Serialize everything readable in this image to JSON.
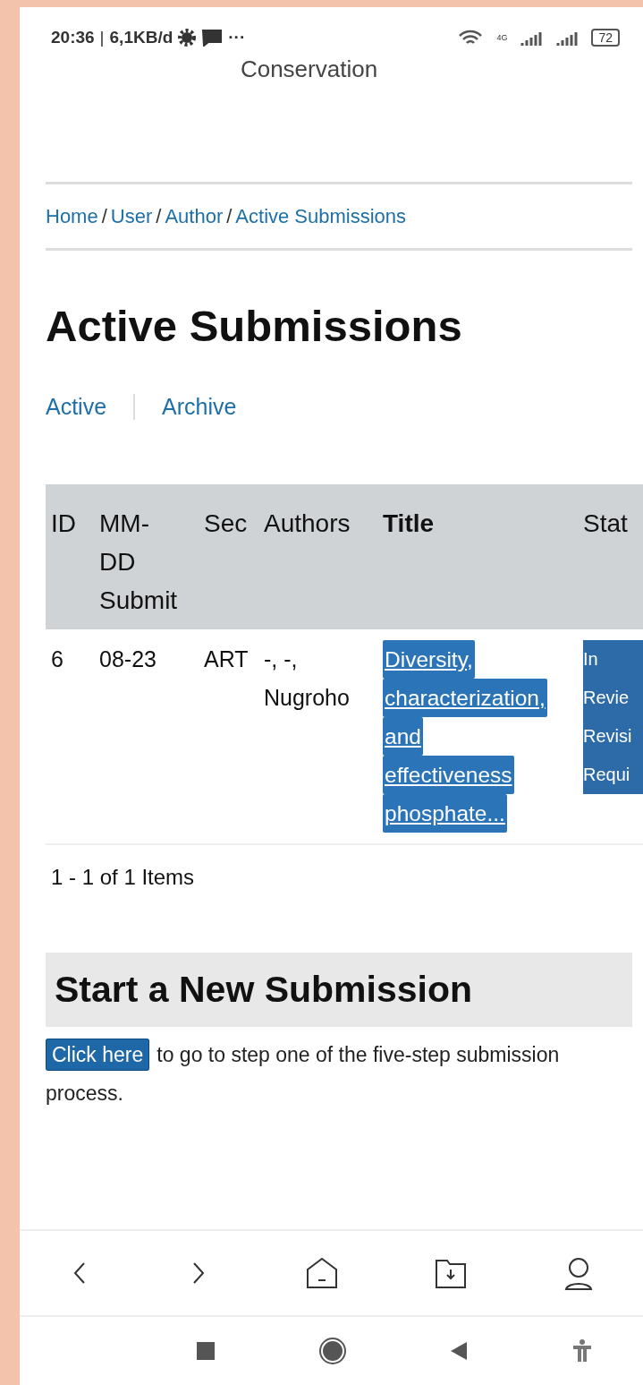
{
  "status_bar": {
    "time": "20:36",
    "separator": "|",
    "speed": "6,1KB/d",
    "more": "···",
    "network": "4G",
    "battery": "72"
  },
  "site_title": "Conservation",
  "breadcrumb": [
    {
      "kind": "link",
      "text": "Home"
    },
    {
      "kind": "separator",
      "text": "/"
    },
    {
      "kind": "link",
      "text": "User"
    },
    {
      "kind": "separator",
      "text": "/"
    },
    {
      "kind": "link",
      "text": "Author"
    },
    {
      "kind": "separator",
      "text": "/"
    },
    {
      "kind": "link",
      "text": "Active Submissions"
    }
  ],
  "page_title": "Active Submissions",
  "tabs": [
    {
      "label": "Active"
    },
    {
      "label": "Archive"
    }
  ],
  "table": {
    "columns": [
      {
        "label": "ID",
        "sorted": false
      },
      {
        "label": "MM-DD Submit",
        "sorted": false
      },
      {
        "label": "Sec",
        "sorted": false
      },
      {
        "label": "Authors",
        "sorted": false
      },
      {
        "label": "Title",
        "sorted": true
      },
      {
        "label": "Stat",
        "sorted": false
      }
    ],
    "rows": [
      {
        "id": "6",
        "date": "08-23",
        "section": "ART",
        "authors": [
          "-, -,",
          "Nugroho"
        ],
        "title": [
          "Diversity,",
          "characterization,",
          "and",
          "effectiveness",
          "phosphate..."
        ],
        "status": [
          "In",
          "Revie",
          "Revisi",
          "Requi"
        ]
      }
    ]
  },
  "pager": "1 - 1 of 1 Items",
  "new_submission": {
    "heading": "Start a New Submission",
    "button": "Click here",
    "text": "to go to step one of the five-step submission process."
  }
}
